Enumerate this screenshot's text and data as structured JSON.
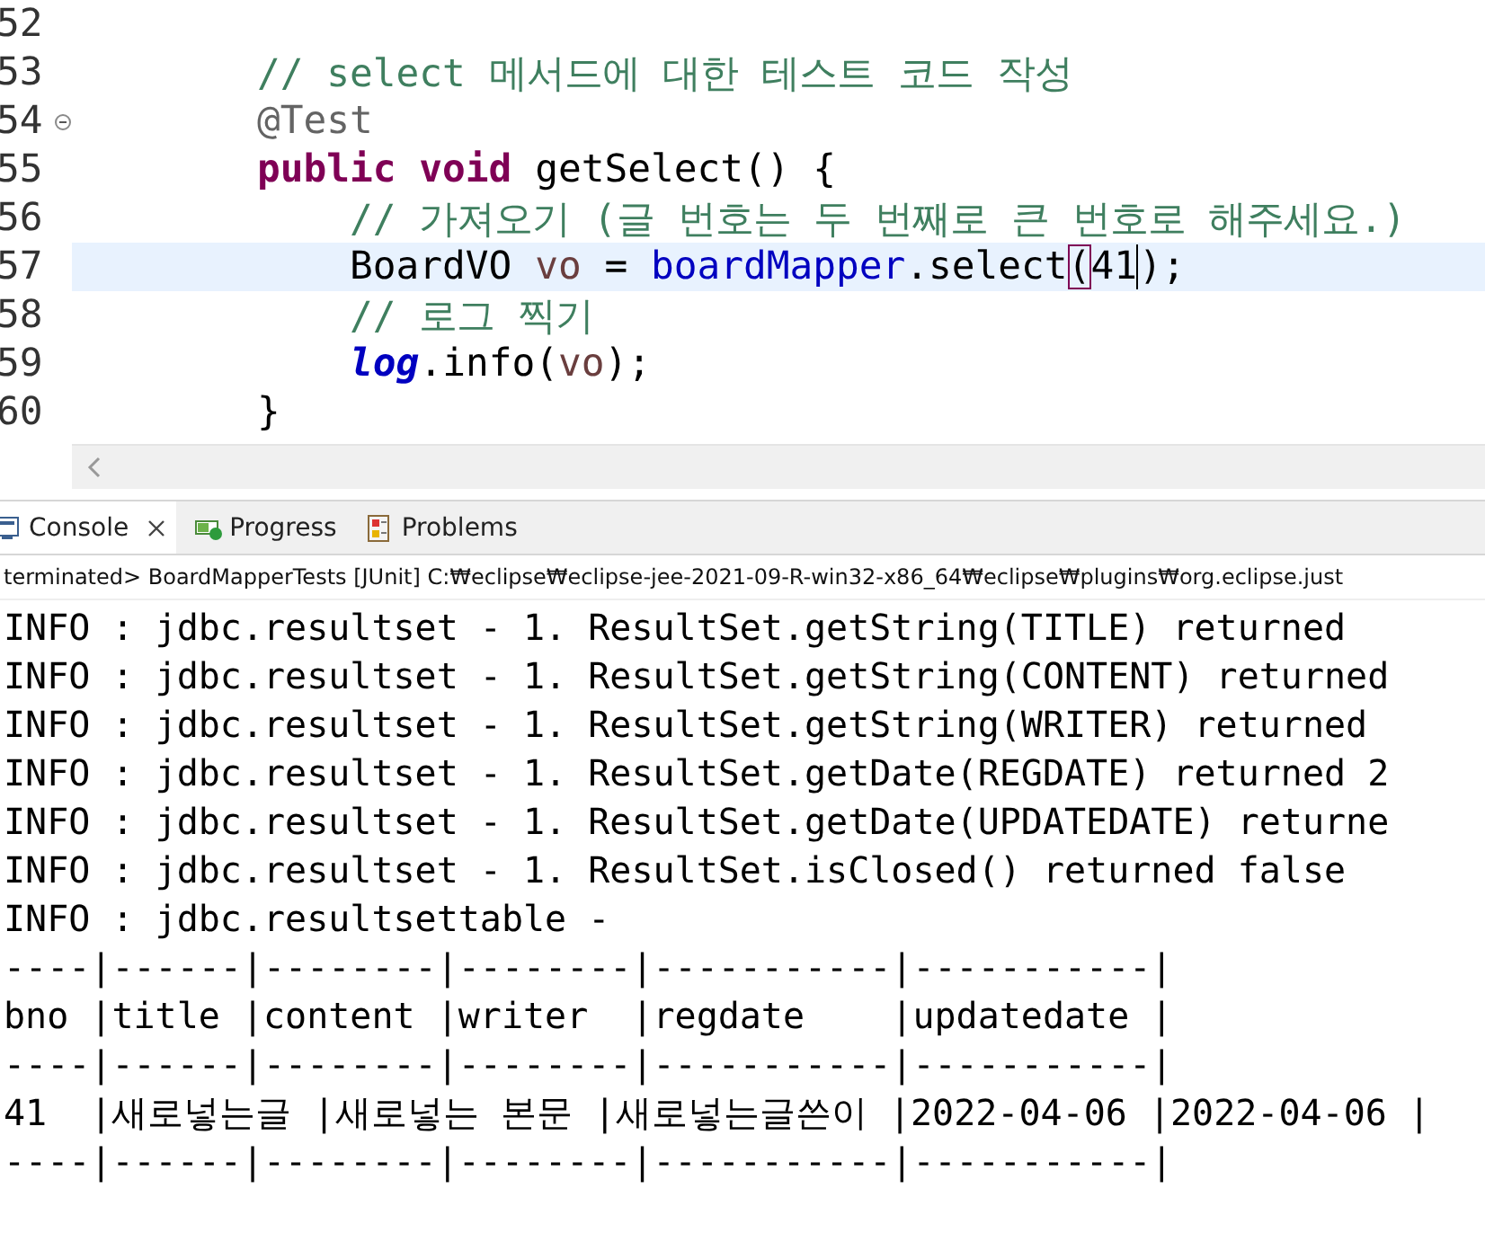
{
  "editor": {
    "lines": [
      {
        "number": "52",
        "current": false,
        "fold": false
      },
      {
        "number": "53",
        "current": false,
        "fold": false,
        "tokens": [
          {
            "text": "        // select 메서드에 대한 테스트 코드 작성",
            "kind": "comment"
          }
        ]
      },
      {
        "number": "54",
        "current": false,
        "fold": true,
        "tokens": [
          {
            "text": "        @Test",
            "kind": "annotation"
          }
        ]
      },
      {
        "number": "55",
        "current": false,
        "fold": false,
        "tokens": [
          {
            "text": "        public",
            "kind": "keyword"
          },
          {
            "text": " void",
            "kind": "keyword"
          },
          {
            "text": " getSelect() {",
            "kind": "plain"
          }
        ]
      },
      {
        "number": "56",
        "current": false,
        "fold": false,
        "tokens": [
          {
            "text": "            // 가져오기 (글 번호는 두 번째로 큰 번호로 해주세요.)",
            "kind": "comment"
          }
        ]
      },
      {
        "number": "57",
        "current": true,
        "fold": false,
        "tokens": [
          {
            "text": "            BoardVO ",
            "kind": "plain"
          },
          {
            "text": "vo",
            "kind": "local"
          },
          {
            "text": " = ",
            "kind": "plain"
          },
          {
            "text": "boardMapper",
            "kind": "field"
          },
          {
            "text": ".select",
            "kind": "plain"
          },
          {
            "text": "(",
            "kind": "bracket-match"
          },
          {
            "text": "41",
            "kind": "plain"
          },
          {
            "text": ");",
            "kind": "caret"
          }
        ]
      },
      {
        "number": "58",
        "current": false,
        "fold": false,
        "tokens": [
          {
            "text": "            // 로그 찍기",
            "kind": "comment"
          }
        ]
      },
      {
        "number": "59",
        "current": false,
        "fold": false,
        "tokens": [
          {
            "text": "            log",
            "kind": "static-field"
          },
          {
            "text": ".info(",
            "kind": "plain"
          },
          {
            "text": "vo",
            "kind": "local"
          },
          {
            "text": ");",
            "kind": "plain"
          }
        ]
      },
      {
        "number": "60",
        "current": false,
        "fold": false,
        "tokens": [
          {
            "text": "        }",
            "kind": "plain"
          }
        ]
      }
    ]
  },
  "tabs": [
    {
      "label": "Console",
      "selected": true,
      "closable": true
    },
    {
      "label": "Progress",
      "selected": false,
      "closable": false
    },
    {
      "label": "Problems",
      "selected": false,
      "closable": false
    }
  ],
  "console": {
    "header": "terminated> BoardMapperTests [JUnit] C:₩eclipse₩eclipse-jee-2021-09-R-win32-x86_64₩eclipse₩plugins₩org.eclipse.just",
    "lines": [
      "INFO : jdbc.resultset - 1. ResultSet.getString(TITLE) returned",
      "INFO : jdbc.resultset - 1. ResultSet.getString(CONTENT) returned",
      "INFO : jdbc.resultset - 1. ResultSet.getString(WRITER) returned",
      "INFO : jdbc.resultset - 1. ResultSet.getDate(REGDATE) returned 2",
      "INFO : jdbc.resultset - 1. ResultSet.getDate(UPDATEDATE) returne",
      "INFO : jdbc.resultset - 1. ResultSet.isClosed() returned false",
      "INFO : jdbc.resultsettable -",
      "----|------|--------|--------|-----------|-----------|",
      "bno |title |content |writer  |regdate    |updatedate |",
      "----|------|--------|--------|-----------|-----------|",
      "41  |새로넣는글 |새로넣는 본문 |새로넣는글쓴이 |2022-04-06 |2022-04-06 |",
      "----|------|--------|--------|-----------|-----------|"
    ]
  }
}
